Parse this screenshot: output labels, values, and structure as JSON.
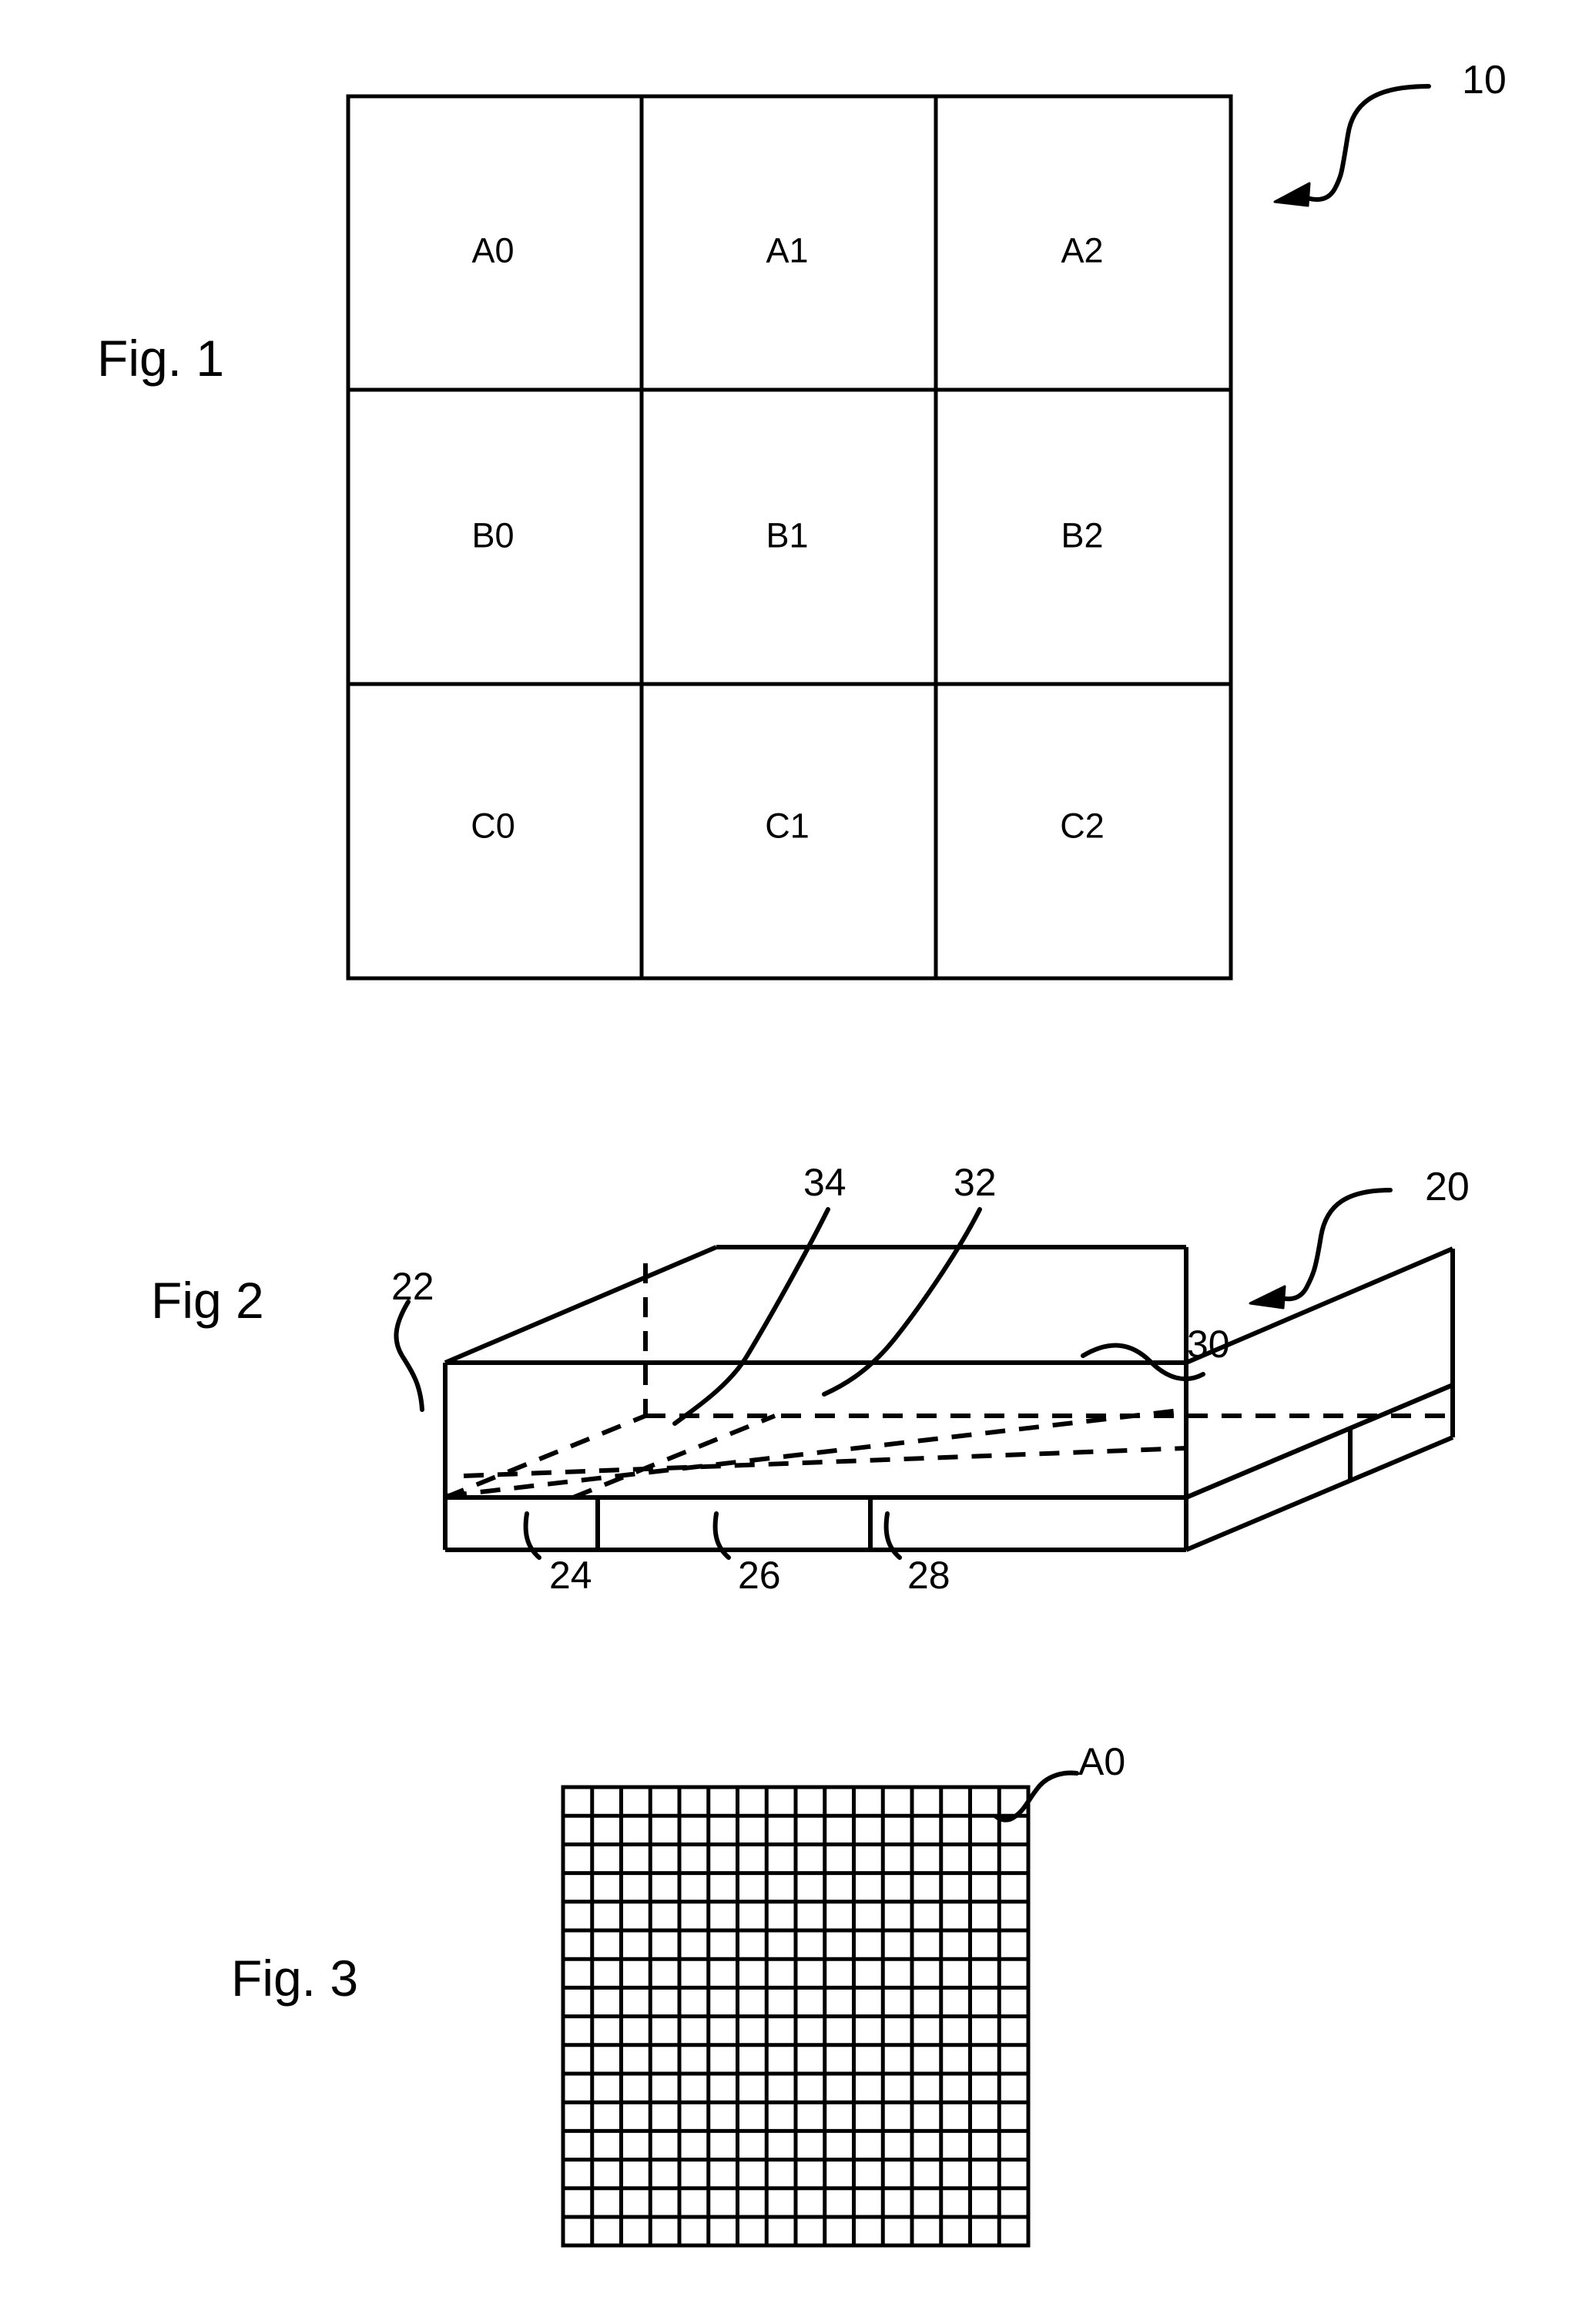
{
  "figures": [
    {
      "id": "figure-1",
      "label": "Fig. 1",
      "reference_numeral": "10",
      "grid": {
        "rows": 3,
        "columns": 3,
        "cells": [
          [
            "A0",
            "A1",
            "A2"
          ],
          [
            "B0",
            "B1",
            "B2"
          ],
          [
            "C0",
            "C1",
            "C2"
          ]
        ]
      }
    },
    {
      "id": "figure-2",
      "label": "Fig 2",
      "reference_numeral": "20",
      "callouts": [
        {
          "name": "top-layer",
          "value": "22"
        },
        {
          "name": "hidden-divider-left",
          "value": "34"
        },
        {
          "name": "hidden-divider-right",
          "value": "32"
        },
        {
          "name": "interface-plane",
          "value": "30"
        },
        {
          "name": "bottom-segment-left",
          "value": "24"
        },
        {
          "name": "bottom-segment-middle",
          "value": "26"
        },
        {
          "name": "bottom-segment-right",
          "value": "28"
        }
      ]
    },
    {
      "id": "figure-3",
      "label": "Fig. 3",
      "reference_numeral": "A0",
      "grid": {
        "rows": 16,
        "columns": 16
      }
    }
  ],
  "fig1_labels": {
    "r0c0": "A0",
    "r0c1": "A1",
    "r0c2": "A2",
    "r1c0": "B0",
    "r1c1": "B1",
    "r1c2": "B2",
    "r2c0": "C0",
    "r2c1": "C1",
    "r2c2": "C2"
  },
  "fig1": {
    "title": "Fig. 1",
    "ref": "10"
  },
  "fig2": {
    "title": "Fig 2",
    "ref": "20",
    "ref22": "22",
    "ref34": "34",
    "ref32": "32",
    "ref30": "30",
    "ref24": "24",
    "ref26": "26",
    "ref28": "28"
  },
  "fig3": {
    "title": "Fig. 3",
    "ref": "A0"
  },
  "style": {
    "stroke": "#000000",
    "background": "#ffffff"
  }
}
